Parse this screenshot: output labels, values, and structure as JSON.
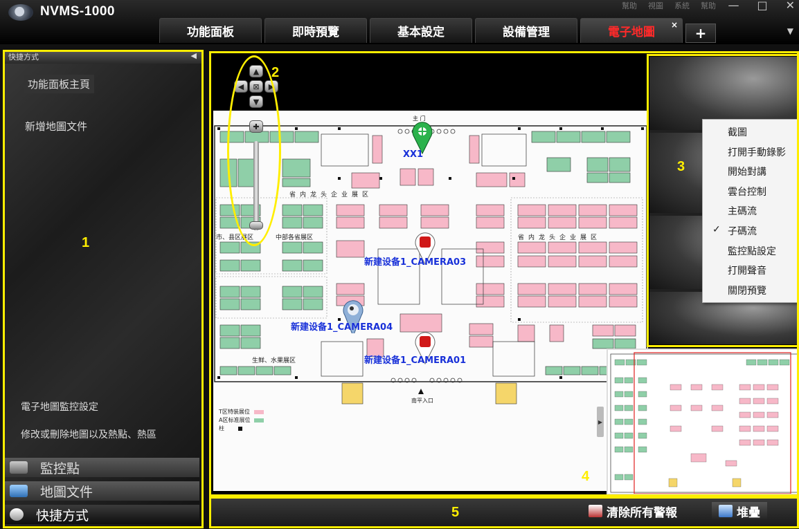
{
  "app": {
    "title": "NVMS-1000"
  },
  "window": {
    "menu": [
      "幫助",
      "視圖",
      "系統",
      "幫助"
    ],
    "minimize": "—",
    "maximize": "□",
    "close": "✕"
  },
  "tabs": [
    {
      "label": "功能面板"
    },
    {
      "label": "即時預覽"
    },
    {
      "label": "基本設定"
    },
    {
      "label": "設備管理"
    },
    {
      "label": "電子地圖",
      "active": true
    }
  ],
  "tab_close": "×",
  "tab_add": "+",
  "tab_dropdown": "▼",
  "left_panel": {
    "header": "快捷方式",
    "collapse": "◀",
    "home": "功能面板主頁",
    "new_map": "新增地圖文件",
    "emap_setting": "電子地圖監控設定",
    "emap_desc": "修改或刪除地圖以及熱點、熱區",
    "accordion": [
      {
        "label": "監控點",
        "icon": "camera-icon"
      },
      {
        "label": "地圖文件",
        "icon": "map-icon"
      },
      {
        "label": "快捷方式",
        "icon": "shortcut-icon",
        "active": true
      }
    ]
  },
  "map": {
    "zones": [
      "省内龙头企业展区",
      "市、县区展区",
      "中部各省展区",
      "省内龙头企业展区",
      "生鲜、水果展区"
    ],
    "entrance_top": "主 门",
    "entrance_bottom": "南平入口",
    "legend": [
      {
        "label": "T区特装展位",
        "color": "#f7b8c8"
      },
      {
        "label": "A区标准展位",
        "color": "#8fcfa8"
      },
      {
        "label": "柱",
        "color": "#111111"
      }
    ],
    "cameras": [
      {
        "label": "XX1",
        "color": "#2bb24c"
      },
      {
        "label": "新建设备1_CAMERA03",
        "color": "#d01818"
      },
      {
        "label": "新建设备1_CAMERA04",
        "color": "#8fb0d8"
      },
      {
        "label": "新建设备1_CAMERA01",
        "color": "#d01818"
      }
    ]
  },
  "context_menu": {
    "items": [
      "截圖",
      "打開手動錄影",
      "開始對講",
      "雲台控制",
      "主碼流",
      "子碼流",
      "監控點設定",
      "打開聲音",
      "關閉預覽"
    ],
    "checked_index": 5,
    "check": "✓"
  },
  "statusbar": {
    "clear_alarms": "清除所有警報",
    "stack": "堆疊"
  },
  "annotations": [
    "1",
    "2",
    "3",
    "4",
    "5"
  ],
  "colors": {
    "annotation": "#ffee00",
    "active_tab_text": "#ff2a2a",
    "booth_pink": "#f7b8c8",
    "booth_green": "#8fcfa8"
  }
}
